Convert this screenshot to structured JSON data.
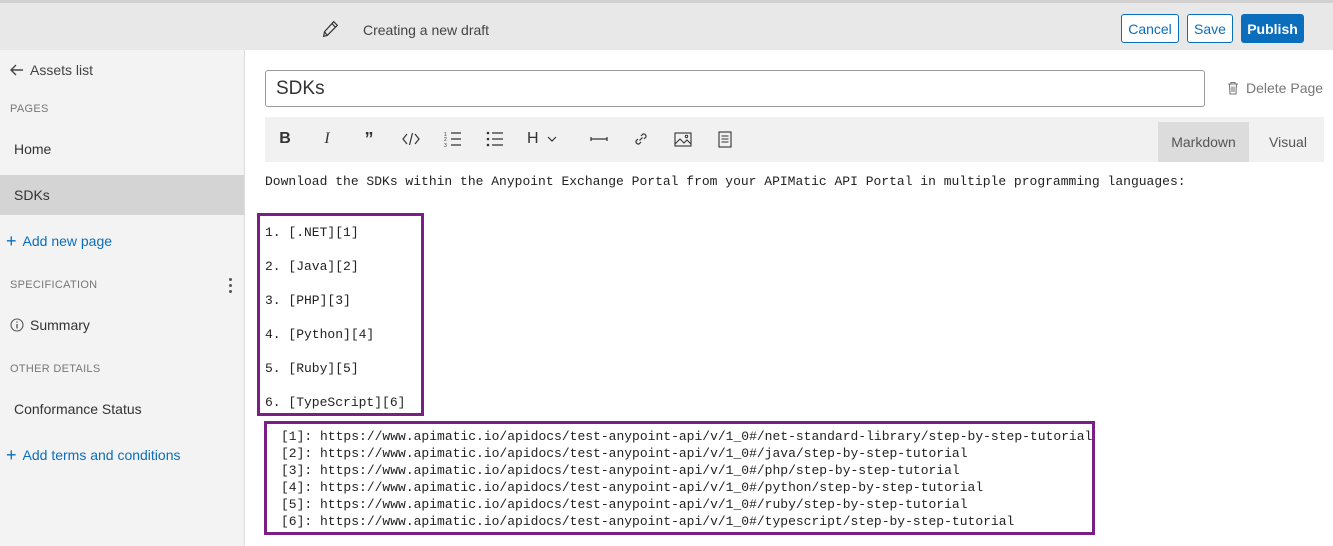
{
  "topbar": {
    "draft_title": "Creating a new draft",
    "cancel_label": "Cancel",
    "save_label": "Save",
    "publish_label": "Publish",
    "accent_color": "#0a6ebd"
  },
  "sidebar": {
    "back_label": "Assets list",
    "pages_heading": "PAGES",
    "pages": [
      {
        "label": "Home",
        "active": false
      },
      {
        "label": "SDKs",
        "active": true
      }
    ],
    "add_page_label": "Add new page",
    "specification_heading": "SPECIFICATION",
    "summary_label": "Summary",
    "other_details_heading": "OTHER DETAILS",
    "conformance_label": "Conformance Status",
    "add_terms_label": "Add terms and conditions"
  },
  "editor": {
    "page_title_value": "SDKs",
    "delete_page_label": "Delete Page",
    "toolbar_icons": [
      "bold-icon",
      "italic-icon",
      "quote-icon",
      "code-icon",
      "ordered-list-icon",
      "unordered-list-icon",
      "heading-icon",
      "horizontal-rule-icon",
      "link-icon",
      "image-icon",
      "table-icon"
    ],
    "heading_label": "H",
    "bold_label": "B",
    "italic_label": "I",
    "tabs": {
      "markdown": "Markdown",
      "visual": "Visual"
    },
    "intro_text": "Download the SDKs within the Anypoint Exchange Portal from your APIMatic API Portal in multiple programming languages:",
    "list_items": [
      "1. [.NET][1]",
      "2. [Java][2]",
      "3. [PHP][3]",
      "4. [Python][4]",
      "5. [Ruby][5]",
      "6. [TypeScript][6]"
    ],
    "references": [
      "[1]: https://www.apimatic.io/apidocs/test-anypoint-api/v/1_0#/net-standard-library/step-by-step-tutorial",
      "[2]: https://www.apimatic.io/apidocs/test-anypoint-api/v/1_0#/java/step-by-step-tutorial",
      "[3]: https://www.apimatic.io/apidocs/test-anypoint-api/v/1_0#/php/step-by-step-tutorial",
      "[4]: https://www.apimatic.io/apidocs/test-anypoint-api/v/1_0#/python/step-by-step-tutorial",
      "[5]: https://www.apimatic.io/apidocs/test-anypoint-api/v/1_0#/ruby/step-by-step-tutorial",
      "[6]: https://www.apimatic.io/apidocs/test-anypoint-api/v/1_0#/typescript/step-by-step-tutorial"
    ],
    "highlight_color": "#7a1f86"
  }
}
